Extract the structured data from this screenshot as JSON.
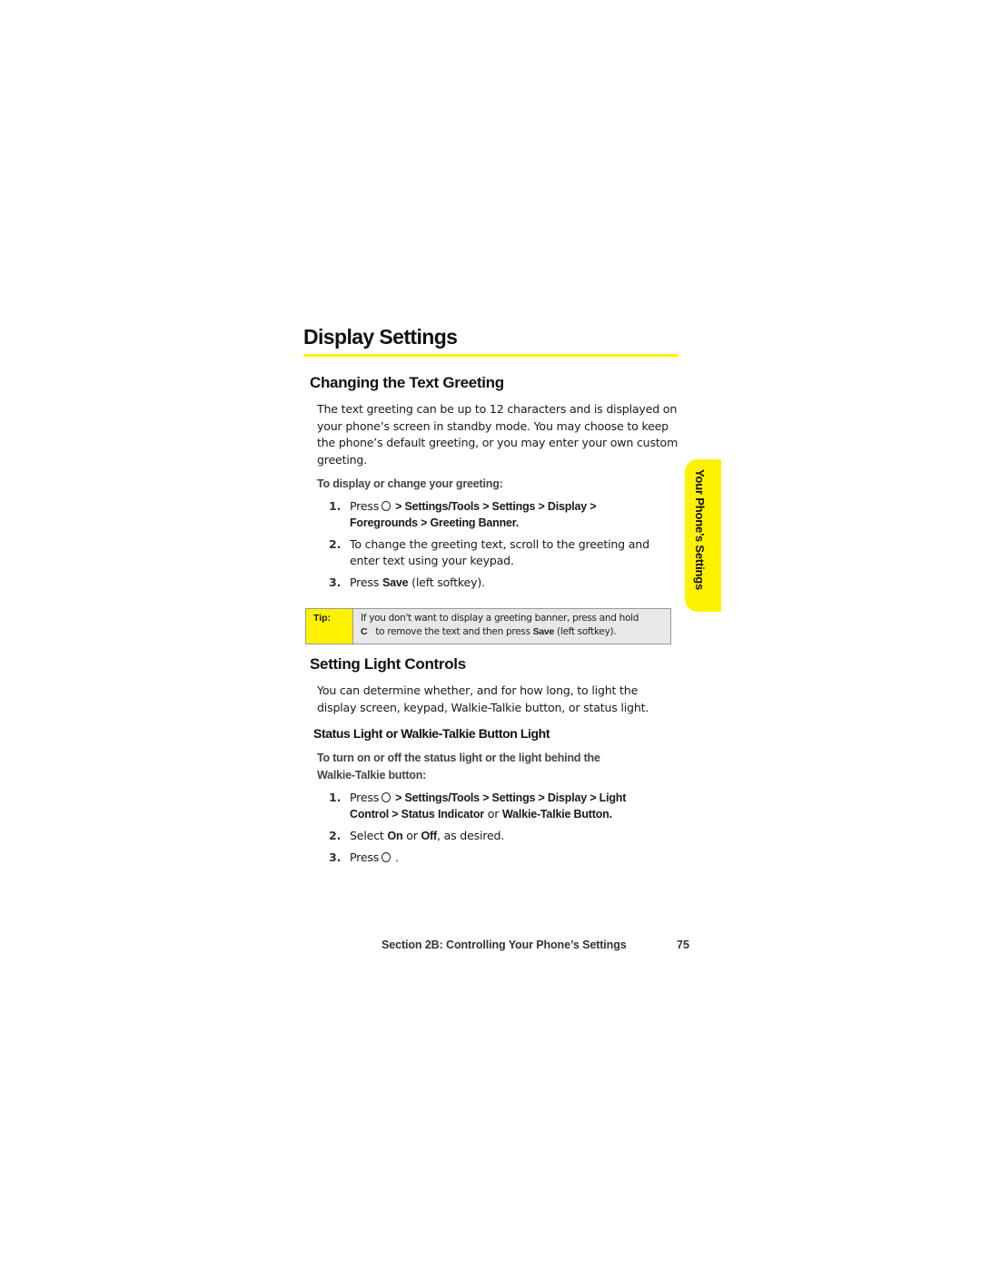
{
  "page": {
    "title": "Display Settings",
    "accent_color": "#fff200"
  },
  "side_tab": {
    "label": "Your Phone’s Settings"
  },
  "section1": {
    "heading": "Changing the Text Greeting",
    "body": "The text greeting can be up to 12 characters and is displayed on your phone’s screen in standby mode. You may choose to keep the phone’s default greeting, or you may enter your own custom greeting.",
    "intro": "To display or change your greeting:",
    "steps": [
      {
        "num": "1.",
        "press": "Press",
        "icon": "menu-ok-key-icon",
        "path_line1": "> Settings/Tools > Settings > Display >",
        "path_line2": "Foregrounds > Greeting Banner."
      },
      {
        "num": "2.",
        "text": "To change the greeting text, scroll to the greeting and enter text using your keypad."
      },
      {
        "num": "3.",
        "pre": "Press ",
        "bold": "Save",
        "post": " (left softkey)."
      }
    ]
  },
  "tip": {
    "label": "Tip:",
    "line1": "If you don't want to display a greeting banner, press and hold",
    "key": "C",
    "line2_pre": " to remove the text and then press ",
    "line2_bold": "Save",
    "line2_post": " (left softkey)."
  },
  "section2": {
    "heading": "Setting Light Controls",
    "body": "You can determine whether, and for how long, to light the display screen, keypad, Walkie-Talkie button, or status light.",
    "subheading": "Status Light or Walkie-Talkie Button Light",
    "intro": "To turn on or off the status light or the light behind the Walkie-Talkie button:",
    "steps": [
      {
        "num": "1.",
        "press": "Press",
        "icon": "menu-ok-key-icon",
        "path_line1": "> Settings/Tools > Settings > Display > Light",
        "path_line2_bold1": "Control > Status Indicator",
        "path_line2_or": " or ",
        "path_line2_bold2": "Walkie-Talkie Button."
      },
      {
        "num": "2.",
        "pre": "Select ",
        "bold1": "On",
        "mid": " or ",
        "bold2": "Off",
        "post": ", as desired."
      },
      {
        "num": "3.",
        "press": "Press",
        "icon": "menu-ok-key-icon",
        "post": "."
      }
    ]
  },
  "footer": {
    "section_label": "Section 2B: Controlling Your Phone’s Settings",
    "page_number": "75"
  }
}
